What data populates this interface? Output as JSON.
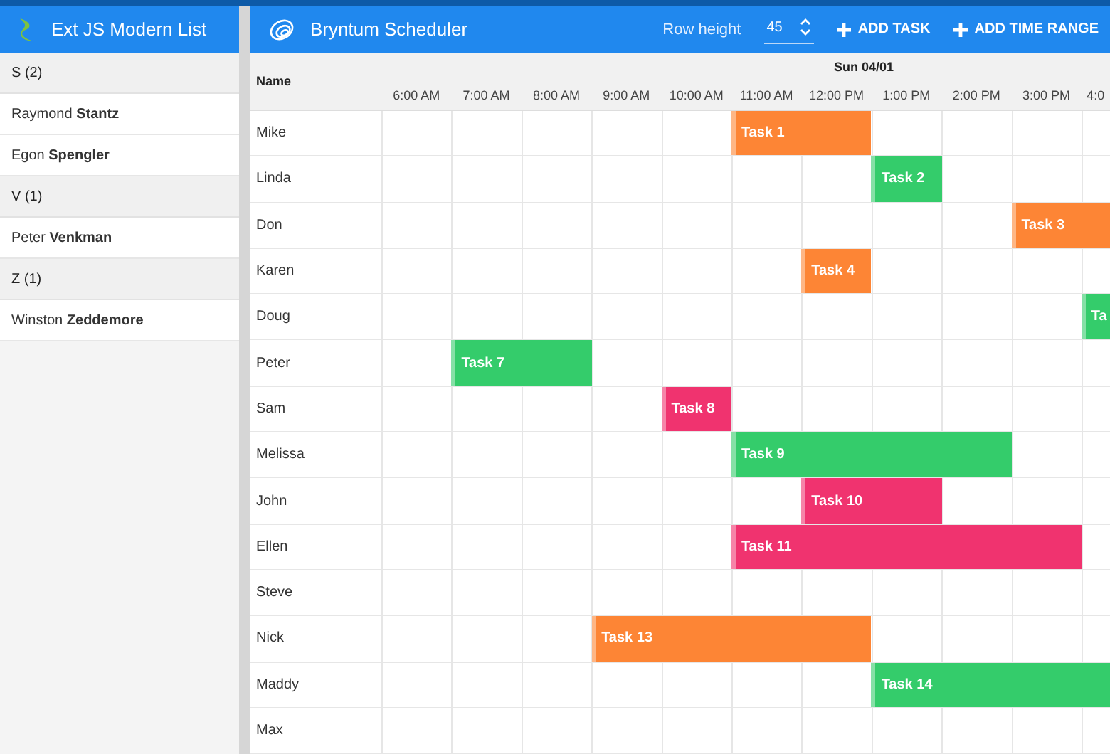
{
  "list_panel": {
    "title": "Ext JS Modern List",
    "groups": [
      {
        "header": "S (2)",
        "items": [
          "Raymond **Stantz**",
          "Egon **Spengler**"
        ]
      },
      {
        "header": "V (1)",
        "items": [
          "Peter **Venkman**"
        ]
      },
      {
        "header": "Z (1)",
        "items": [
          "Winston **Zeddemore**"
        ]
      }
    ]
  },
  "scheduler": {
    "title": "Bryntum Scheduler",
    "row_height": {
      "label": "Row height",
      "value": "45"
    },
    "buttons": [
      {
        "label": "ADD TASK"
      },
      {
        "label": "ADD TIME RANGE"
      }
    ],
    "name_column": "Name",
    "date": "Sun 04/01",
    "hours": [
      "6:00 AM",
      "7:00 AM",
      "8:00 AM",
      "9:00 AM",
      "10:00 AM",
      "11:00 AM",
      "12:00 PM",
      "1:00 PM",
      "2:00 PM",
      "3:00 PM",
      "4:0"
    ],
    "rows": [
      {
        "name": "Mike",
        "slots": [
          {
            "kind": "empty"
          },
          {
            "kind": "empty"
          },
          {
            "kind": "empty"
          },
          {
            "kind": "empty"
          },
          {
            "kind": "empty"
          },
          {
            "kind": "task",
            "label": "Task 1",
            "color": "#fd8535"
          },
          {
            "kind": "continued"
          }
        ]
      },
      {
        "name": "Linda",
        "slots": [
          {
            "kind": "empty"
          },
          {
            "kind": "empty"
          },
          {
            "kind": "empty"
          },
          {
            "kind": "empty"
          },
          {
            "kind": "empty"
          },
          {
            "kind": "empty"
          },
          {
            "kind": "empty"
          },
          {
            "kind": "task",
            "label": "Task 2",
            "color": "#34cc6b"
          }
        ]
      },
      {
        "name": "Don",
        "slots": [
          {
            "kind": "empty"
          },
          {
            "kind": "empty"
          },
          {
            "kind": "empty"
          },
          {
            "kind": "empty"
          },
          {
            "kind": "empty"
          },
          {
            "kind": "empty"
          },
          {
            "kind": "empty"
          },
          {
            "kind": "empty"
          },
          {
            "kind": "empty"
          },
          {
            "kind": "task",
            "label": "Task 3",
            "color": "#fd8535"
          },
          {
            "kind": "continued"
          }
        ]
      },
      {
        "name": "Karen",
        "slots": [
          {
            "kind": "empty"
          },
          {
            "kind": "empty"
          },
          {
            "kind": "empty"
          },
          {
            "kind": "empty"
          },
          {
            "kind": "empty"
          },
          {
            "kind": "empty"
          },
          {
            "kind": "task",
            "label": "Task 4",
            "color": "#fd8535"
          }
        ]
      },
      {
        "name": "Doug",
        "slots": [
          {
            "kind": "empty"
          },
          {
            "kind": "empty"
          },
          {
            "kind": "empty"
          },
          {
            "kind": "empty"
          },
          {
            "kind": "empty"
          },
          {
            "kind": "empty"
          },
          {
            "kind": "empty"
          },
          {
            "kind": "empty"
          },
          {
            "kind": "empty"
          },
          {
            "kind": "empty"
          },
          {
            "kind": "task",
            "label": "Ta",
            "color": "#34cc6b"
          }
        ]
      },
      {
        "name": "Peter",
        "slots": [
          {
            "kind": "empty"
          },
          {
            "kind": "task",
            "label": "Task 7",
            "color": "#34cc6b"
          },
          {
            "kind": "continued"
          }
        ]
      },
      {
        "name": "Sam",
        "slots": [
          {
            "kind": "empty"
          },
          {
            "kind": "empty"
          },
          {
            "kind": "empty"
          },
          {
            "kind": "empty"
          },
          {
            "kind": "task",
            "label": "Task 8",
            "color": "#f0336f"
          }
        ]
      },
      {
        "name": "Melissa",
        "slots": [
          {
            "kind": "empty"
          },
          {
            "kind": "empty"
          },
          {
            "kind": "empty"
          },
          {
            "kind": "empty"
          },
          {
            "kind": "empty"
          },
          {
            "kind": "task",
            "label": "Task 9",
            "color": "#34cc6b"
          },
          {
            "kind": "continued"
          },
          {
            "kind": "continued"
          },
          {
            "kind": "continued"
          }
        ]
      },
      {
        "name": "John",
        "slots": [
          {
            "kind": "empty"
          },
          {
            "kind": "empty"
          },
          {
            "kind": "empty"
          },
          {
            "kind": "empty"
          },
          {
            "kind": "empty"
          },
          {
            "kind": "empty"
          },
          {
            "kind": "task",
            "label": "Task 10",
            "color": "#f0336f"
          },
          {
            "kind": "continued"
          }
        ]
      },
      {
        "name": "Ellen",
        "slots": [
          {
            "kind": "empty"
          },
          {
            "kind": "empty"
          },
          {
            "kind": "empty"
          },
          {
            "kind": "empty"
          },
          {
            "kind": "empty"
          },
          {
            "kind": "task",
            "label": "Task 11",
            "color": "#f0336f"
          },
          {
            "kind": "continued"
          },
          {
            "kind": "continued"
          },
          {
            "kind": "continued"
          },
          {
            "kind": "continued"
          }
        ]
      },
      {
        "name": "Steve"
      },
      {
        "name": "Nick",
        "slots": [
          {
            "kind": "empty"
          },
          {
            "kind": "empty"
          },
          {
            "kind": "empty"
          },
          {
            "kind": "task",
            "label": "Task 13",
            "color": "#fd8535"
          },
          {
            "kind": "continued"
          },
          {
            "kind": "continued"
          },
          {
            "kind": "continued"
          }
        ]
      },
      {
        "name": "Maddy",
        "slots": [
          {
            "kind": "empty"
          },
          {
            "kind": "empty"
          },
          {
            "kind": "empty"
          },
          {
            "kind": "empty"
          },
          {
            "kind": "empty"
          },
          {
            "kind": "empty"
          },
          {
            "kind": "empty"
          },
          {
            "kind": "task",
            "label": "Task 14",
            "color": "#34cc6b"
          },
          {
            "kind": "continued"
          },
          {
            "kind": "continued"
          },
          {
            "kind": "continued"
          }
        ]
      },
      {
        "name": "Max"
      }
    ]
  }
}
